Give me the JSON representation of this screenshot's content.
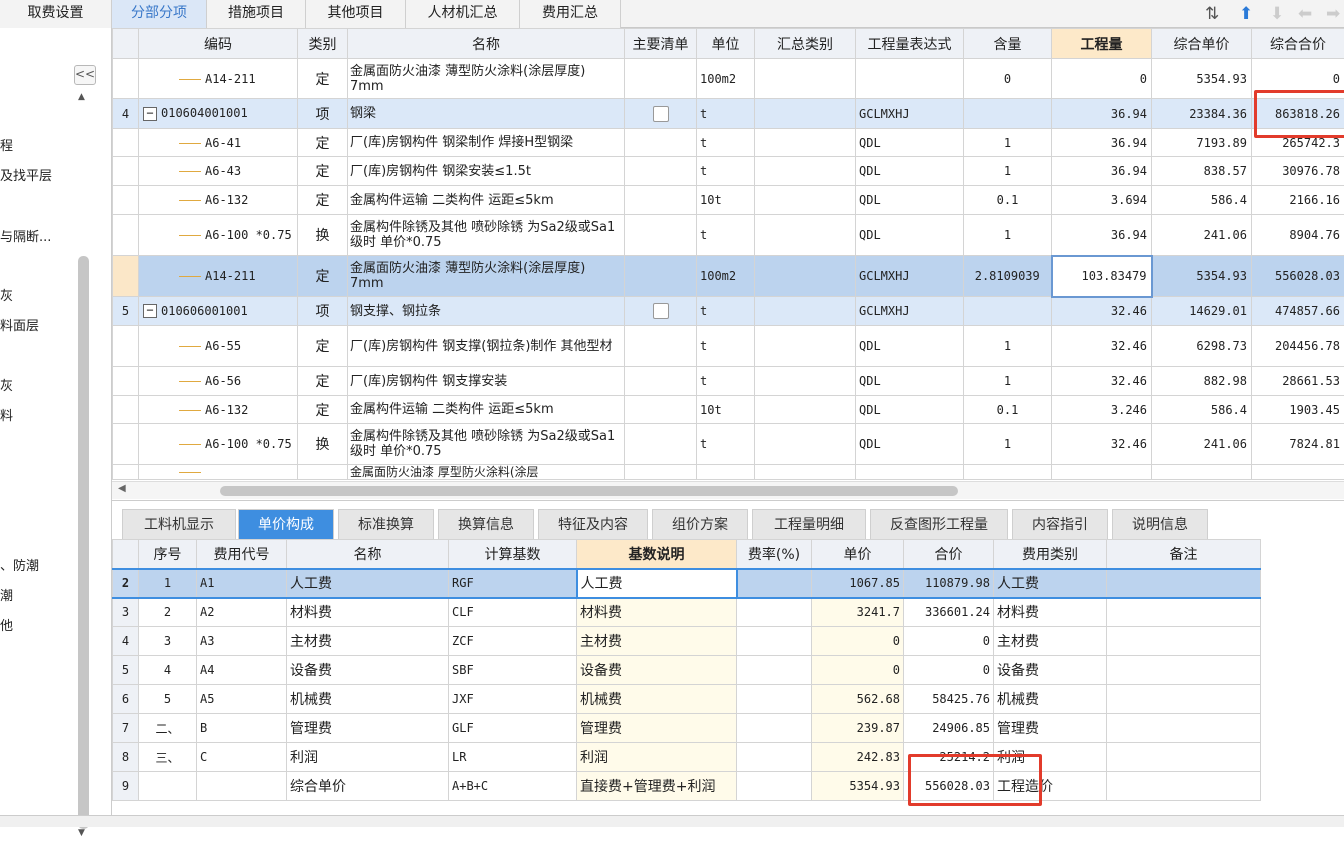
{
  "top_tabs": [
    {
      "label": "取费设置",
      "active": false
    },
    {
      "label": "分部分项",
      "active": true
    },
    {
      "label": "措施项目",
      "active": false
    },
    {
      "label": "其他项目",
      "active": false
    },
    {
      "label": "人材机汇总",
      "active": false
    },
    {
      "label": "费用汇总",
      "active": false
    }
  ],
  "left_panel": {
    "collapse": "<<",
    "items": [
      "程",
      "及找平层",
      "与隔断...",
      "灰",
      "料面层",
      "灰",
      "料",
      "、防潮",
      "潮",
      "他"
    ]
  },
  "grid": {
    "headers": [
      "编码",
      "类别",
      "名称",
      "主要清单",
      "单位",
      "汇总类别",
      "工程量表达式",
      "含量",
      "工程量",
      "综合单价",
      "综合合价"
    ],
    "rows": [
      {
        "no": "",
        "code": "A14-211",
        "kind": "sub",
        "type": "定",
        "name": "金属面防火油漆 薄型防火涂料(涂层厚度) 7mm",
        "unit": "100m2",
        "expr": "",
        "content": "0",
        "qty": "0",
        "price": "5354.93",
        "total": "0"
      },
      {
        "no": "4",
        "code": "010604001001",
        "kind": "item",
        "type": "项",
        "name": "钢梁",
        "unit": "t",
        "expr": "GCLMXHJ",
        "content": "",
        "qty": "36.94",
        "price": "23384.36",
        "total": "863818.26"
      },
      {
        "no": "",
        "code": "A6-41",
        "kind": "sub",
        "type": "定",
        "name": "厂(库)房钢构件 钢梁制作 焊接H型钢梁",
        "unit": "t",
        "expr": "QDL",
        "content": "1",
        "qty": "36.94",
        "price": "7193.89",
        "total": "265742.3"
      },
      {
        "no": "",
        "code": "A6-43",
        "kind": "sub",
        "type": "定",
        "name": "厂(库)房钢构件 钢梁安装≤1.5t",
        "unit": "t",
        "expr": "QDL",
        "content": "1",
        "qty": "36.94",
        "price": "838.57",
        "total": "30976.78"
      },
      {
        "no": "",
        "code": "A6-132",
        "kind": "sub",
        "type": "定",
        "name": "金属构件运输 二类构件 运距≤5km",
        "unit": "10t",
        "expr": "QDL",
        "content": "0.1",
        "qty": "3.694",
        "price": "586.4",
        "total": "2166.16"
      },
      {
        "no": "",
        "code": "A6-100 *0.75",
        "kind": "sub",
        "type": "换",
        "name": "金属构件除锈及其他 喷砂除锈 为Sa2级或Sa1级时 单价*0.75",
        "unit": "t",
        "expr": "QDL",
        "content": "1",
        "qty": "36.94",
        "price": "241.06",
        "total": "8904.76"
      },
      {
        "no": "",
        "code": "A14-211",
        "kind": "selected",
        "type": "定",
        "name": "金属面防火油漆 薄型防火涂料(涂层厚度) 7mm",
        "unit": "100m2",
        "expr": "GCLMXHJ",
        "content": "2.8109039",
        "qty": "103.83479",
        "price": "5354.93",
        "total": "556028.03"
      },
      {
        "no": "5",
        "code": "010606001001",
        "kind": "item",
        "type": "项",
        "name": "钢支撑、钢拉条",
        "unit": "t",
        "expr": "GCLMXHJ",
        "content": "",
        "qty": "32.46",
        "price": "14629.01",
        "total": "474857.66"
      },
      {
        "no": "",
        "code": "A6-55",
        "kind": "sub",
        "type": "定",
        "name": "厂(库)房钢构件 钢支撑(钢拉条)制作 其他型材",
        "unit": "t",
        "expr": "QDL",
        "content": "1",
        "qty": "32.46",
        "price": "6298.73",
        "total": "204456.78"
      },
      {
        "no": "",
        "code": "A6-56",
        "kind": "sub",
        "type": "定",
        "name": "厂(库)房钢构件 钢支撑安装",
        "unit": "t",
        "expr": "QDL",
        "content": "1",
        "qty": "32.46",
        "price": "882.98",
        "total": "28661.53"
      },
      {
        "no": "",
        "code": "A6-132",
        "kind": "sub",
        "type": "定",
        "name": "金属构件运输 二类构件 运距≤5km",
        "unit": "10t",
        "expr": "QDL",
        "content": "0.1",
        "qty": "3.246",
        "price": "586.4",
        "total": "1903.45"
      },
      {
        "no": "",
        "code": "A6-100 *0.75",
        "kind": "sub",
        "type": "换",
        "name": "金属构件除锈及其他 喷砂除锈 为Sa2级或Sa1级时 单价*0.75",
        "unit": "t",
        "expr": "QDL",
        "content": "1",
        "qty": "32.46",
        "price": "241.06",
        "total": "7824.81"
      },
      {
        "no": "",
        "code": "",
        "kind": "sub",
        "type": "",
        "name": "金属面防火油漆 厚型防火涂料(涂层",
        "unit": "",
        "expr": "",
        "content": "",
        "qty": "",
        "price": "",
        "total": ""
      }
    ]
  },
  "bottom_tabs": [
    {
      "label": "工料机显示",
      "active": false
    },
    {
      "label": "单价构成",
      "active": true
    },
    {
      "label": "标准换算",
      "active": false
    },
    {
      "label": "换算信息",
      "active": false
    },
    {
      "label": "特征及内容",
      "active": false
    },
    {
      "label": "组价方案",
      "active": false
    },
    {
      "label": "工程量明细",
      "active": false
    },
    {
      "label": "反查图形工程量",
      "active": false
    },
    {
      "label": "内容指引",
      "active": false
    },
    {
      "label": "说明信息",
      "active": false
    }
  ],
  "cost_grid": {
    "headers": [
      "序号",
      "费用代号",
      "名称",
      "计算基数",
      "基数说明",
      "费率(%)",
      "单价",
      "合价",
      "费用类别",
      "备注"
    ],
    "rows": [
      {
        "row": "2",
        "seq": "1",
        "code": "A1",
        "name": "人工费",
        "base": "RGF",
        "desc": "人工费",
        "rate": "",
        "unit_price": "1067.85",
        "total": "110879.98",
        "category": "人工费",
        "note": ""
      },
      {
        "row": "3",
        "seq": "2",
        "code": "A2",
        "name": "材料费",
        "base": "CLF",
        "desc": "材料费",
        "rate": "",
        "unit_price": "3241.7",
        "total": "336601.24",
        "category": "材料费",
        "note": ""
      },
      {
        "row": "4",
        "seq": "3",
        "code": "A3",
        "name": "主材费",
        "base": "ZCF",
        "desc": "主材费",
        "rate": "",
        "unit_price": "0",
        "total": "0",
        "category": "主材费",
        "note": ""
      },
      {
        "row": "5",
        "seq": "4",
        "code": "A4",
        "name": "设备费",
        "base": "SBF",
        "desc": "设备费",
        "rate": "",
        "unit_price": "0",
        "total": "0",
        "category": "设备费",
        "note": ""
      },
      {
        "row": "6",
        "seq": "5",
        "code": "A5",
        "name": "机械费",
        "base": "JXF",
        "desc": "机械费",
        "rate": "",
        "unit_price": "562.68",
        "total": "58425.76",
        "category": "机械费",
        "note": ""
      },
      {
        "row": "7",
        "seq": "二、",
        "code": "B",
        "name": "管理费",
        "base": "GLF",
        "desc": "管理费",
        "rate": "",
        "unit_price": "239.87",
        "total": "24906.85",
        "category": "管理费",
        "note": ""
      },
      {
        "row": "8",
        "seq": "三、",
        "code": "C",
        "name": "利润",
        "base": "LR",
        "desc": "利润",
        "rate": "",
        "unit_price": "242.83",
        "total": "25214.2",
        "category": "利润",
        "note": ""
      },
      {
        "row": "9",
        "seq": "",
        "code": "",
        "name": "综合单价",
        "base": "A+B+C",
        "desc": "直接费+管理费+利润",
        "rate": "",
        "unit_price": "5354.93",
        "total": "556028.03",
        "category": "工程造价",
        "note": ""
      }
    ]
  },
  "colors": {
    "highlight_box": "#e23b2b",
    "active_tab": "#3e8ee0",
    "item_row": "#dbe8f8",
    "selected_row": "#bcd3ee"
  }
}
